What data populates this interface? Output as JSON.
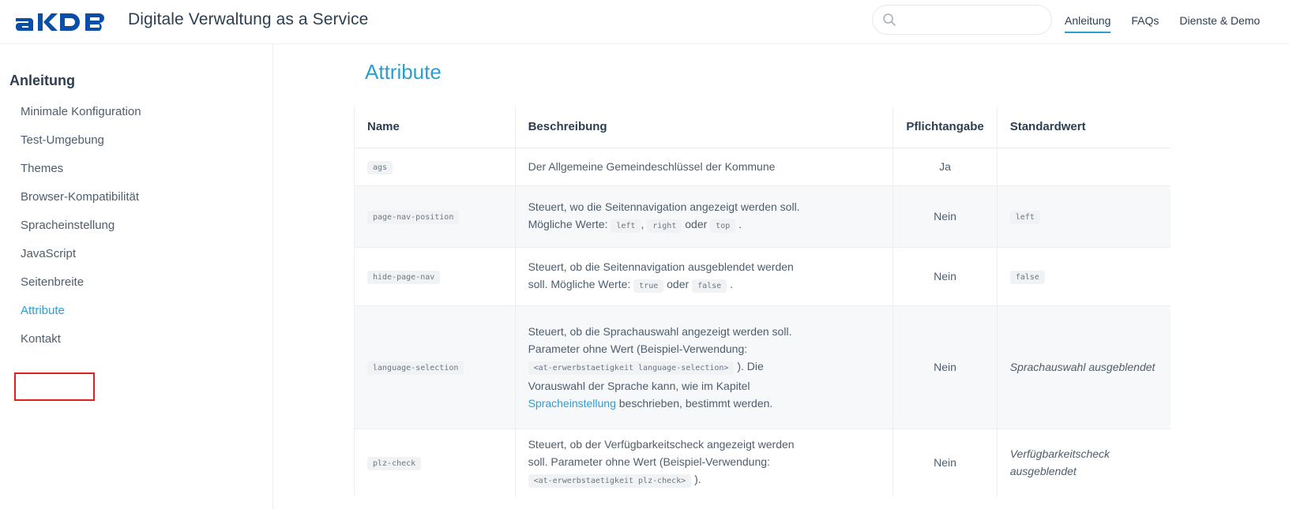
{
  "header": {
    "logo_text": "aKDB",
    "title": "Digitale Verwaltung as a Service",
    "search_placeholder": "",
    "nav": [
      "Anleitung",
      "FAQs",
      "Dienste & Demo"
    ],
    "accent": "#2a9fd6",
    "logo_color": "#0a4ea8"
  },
  "sidebar": {
    "heading": "Anleitung",
    "items": [
      "Minimale Konfiguration",
      "Test-Umgebung",
      "Themes",
      "Browser-Kompatibilität",
      "Spracheinstellung",
      "JavaScript",
      "Seitenbreite",
      "Attribute",
      "Kontakt"
    ],
    "active_item": "Attribute"
  },
  "main": {
    "heading": "Attribute",
    "table": {
      "headers": [
        "Name",
        "Beschreibung",
        "Pflichtangabe",
        "Standardwert"
      ],
      "rows": [
        {
          "name": "ags",
          "desc1": "Der Allgemeine Gemeindeschlüssel der Kommune",
          "required": "Ja",
          "default": ""
        },
        {
          "name": "page-nav-position",
          "desc1": "Steuert, wo die Seitennavigation angezeigt werden soll.",
          "desc2": "Mögliche Werte:",
          "code1": "left",
          "sep1": ",",
          "code2": "right",
          "sep2": "oder",
          "code3": "top",
          "end": ".",
          "required": "Nein",
          "default_code": "left"
        },
        {
          "name": "hide-page-nav",
          "desc1": "Steuert, ob die Seitennavigation ausgeblendet werden",
          "desc2": "soll. Mögliche Werte:",
          "code1": "true",
          "sep1": "oder",
          "code2": "false",
          "end": ".",
          "required": "Nein",
          "default_code": "false"
        },
        {
          "name": "language-selection",
          "desc1": "Steuert, ob die Sprachauswahl angezeigt werden soll.",
          "desc2": "Parameter ohne Wert (Beispiel-Verwendung:",
          "code1": "<at-erwerbstaetigkeit language-selection>",
          "desc3": "). Die",
          "desc4": "Vorauswahl der Sprache kann, wie im Kapitel",
          "link": "Spracheinstellung",
          "desc5": "beschrieben, bestimmt werden.",
          "required": "Nein",
          "default_italic": "Sprachauswahl ausgeblendet"
        },
        {
          "name": "plz-check",
          "desc1": "Steuert, ob der Verfügbarkeitscheck angezeigt werden",
          "desc2": "soll. Parameter ohne Wert (Beispiel-Verwendung:",
          "code1": "<at-erwerbstaetigkeit plz-check>",
          "desc3": ").",
          "required": "Nein",
          "default_italic": "Verfügbarkeitscheck ausgeblendet"
        }
      ]
    }
  }
}
